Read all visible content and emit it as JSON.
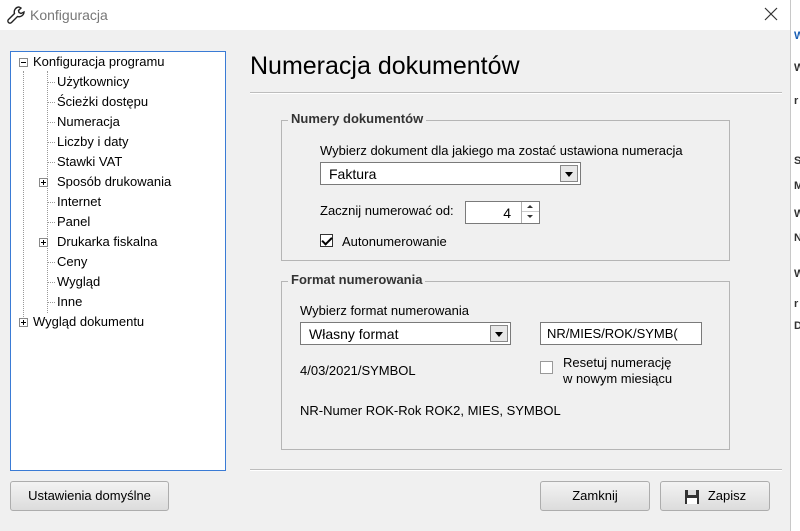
{
  "window": {
    "title": "Konfiguracja",
    "edge_chars": [
      "W",
      "W",
      "r",
      "S",
      "M",
      "W",
      "N",
      "W",
      "r",
      "D"
    ]
  },
  "tree": {
    "root": "Konfiguracja programu",
    "items": [
      "Użytkownicy",
      "Ścieżki dostępu",
      "Numeracja",
      "Liczby i daty",
      "Stawki VAT",
      "Sposób drukowania",
      "Internet",
      "Panel",
      "Drukarka fiskalna",
      "Ceny",
      "Wygląd",
      "Inne"
    ],
    "root2": "Wygląd dokumentu"
  },
  "panel": {
    "title": "Numeracja dokumentów"
  },
  "numbers_group": {
    "legend": "Numery dokumentów",
    "choose_label": "Wybierz dokument dla jakiego ma zostać ustawiona numeracja",
    "document_type": "Faktura",
    "start_label": "Zacznij numerować od:",
    "start_value": "4",
    "auto_label": "Autonumerowanie",
    "auto_checked": true
  },
  "format_group": {
    "legend": "Format numerowania",
    "choose_label": "Wybierz format numerowania",
    "format_value": "Własny format",
    "pattern_value": "NR/MIES/ROK/SYMB(",
    "preview": "4/03/2021/SYMBOL",
    "reset_label_line1": "Resetuj numerację",
    "reset_label_line2": "w nowym miesiącu",
    "reset_checked": false,
    "legend_hint": "NR-Numer ROK-Rok ROK2, MIES, SYMBOL"
  },
  "buttons": {
    "defaults": "Ustawienia domyślne",
    "close": "Zamknij",
    "save": "Zapisz"
  }
}
